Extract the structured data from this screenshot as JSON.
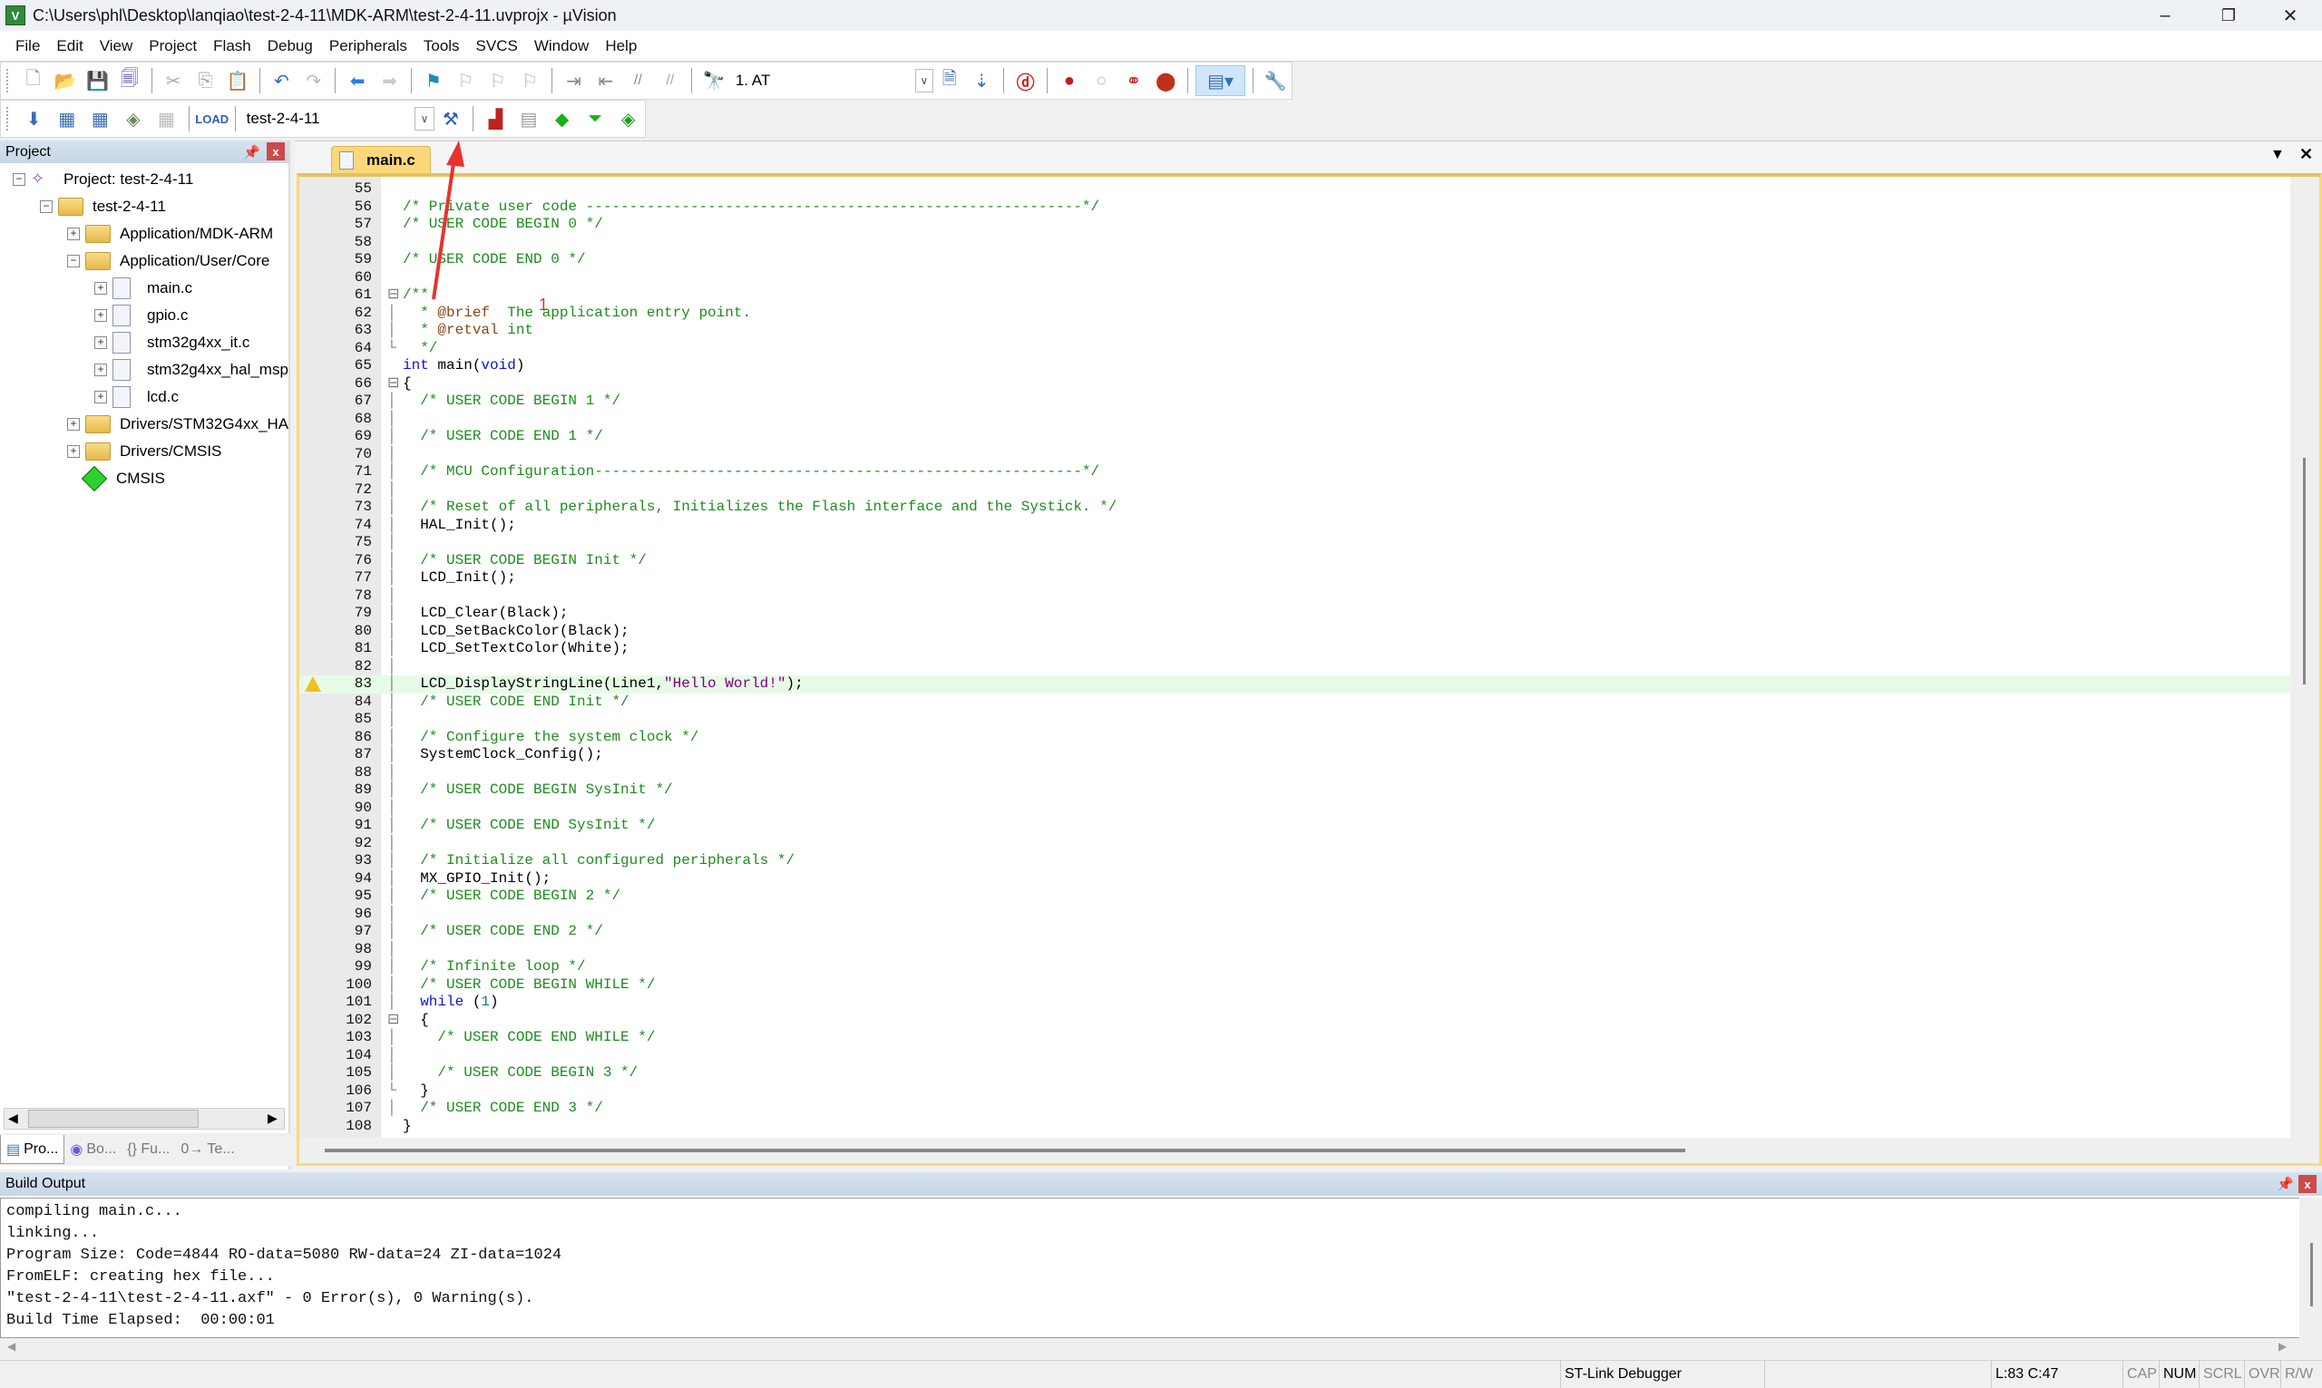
{
  "window": {
    "title": "C:\\Users\\phl\\Desktop\\lanqiao\\test-2-4-11\\MDK-ARM\\test-2-4-11.uvprojx - µVision",
    "minimize": "–",
    "restore": "❐",
    "close": "✕"
  },
  "menu": [
    "File",
    "Edit",
    "View",
    "Project",
    "Flash",
    "Debug",
    "Peripherals",
    "Tools",
    "SVCS",
    "Window",
    "Help"
  ],
  "toolbar1": {
    "icons": [
      "new-file-icon",
      "open-file-icon",
      "save-icon",
      "save-all-icon",
      "cut-icon",
      "copy-icon",
      "paste-icon",
      "undo-icon",
      "redo-icon",
      "navigate-back-icon",
      "navigate-forward-icon",
      "bookmark-icon",
      "prev-bookmark-icon",
      "next-bookmark-icon",
      "clear-bookmarks-icon",
      "indent-icon",
      "unindent-icon",
      "comment-icon",
      "uncomment-icon",
      "find-in-files-icon"
    ],
    "find_combo_value": "1. AT",
    "right_icons": [
      "find-icon",
      "incremental-find-icon",
      "debug-session-icon",
      "breakpoint-icon",
      "disable-breakpoint-icon",
      "disable-all-breakpoints-icon",
      "kill-all-breakpoints-icon",
      "window-layout-icon",
      "configure-icon"
    ]
  },
  "toolbar2": {
    "icons": [
      "translate-icon",
      "build-icon",
      "rebuild-icon",
      "batch-build-icon",
      "stop-build-icon",
      "download-icon"
    ],
    "target_value": "test-2-4-11",
    "right_icons": [
      "options-for-target-icon",
      "manage-project-items-icon",
      "select-packs-icon",
      "manage-run-time-environment-icon",
      "pack-installer-icon",
      "pack-manager-icon"
    ]
  },
  "project_panel": {
    "title": "Project",
    "tree": [
      {
        "label": "Project: test-2-4-11",
        "level": 0,
        "type": "project",
        "expander": "−"
      },
      {
        "label": "test-2-4-11",
        "level": 1,
        "type": "target",
        "expander": "−"
      },
      {
        "label": "Application/MDK-ARM",
        "level": 2,
        "type": "folder",
        "expander": "+"
      },
      {
        "label": "Application/User/Core",
        "level": 2,
        "type": "folder-open",
        "expander": "−"
      },
      {
        "label": "main.c",
        "level": 3,
        "type": "file",
        "expander": "+"
      },
      {
        "label": "gpio.c",
        "level": 3,
        "type": "file",
        "expander": "+"
      },
      {
        "label": "stm32g4xx_it.c",
        "level": 3,
        "type": "file",
        "expander": "+"
      },
      {
        "label": "stm32g4xx_hal_msp",
        "level": 3,
        "type": "file",
        "expander": "+"
      },
      {
        "label": "lcd.c",
        "level": 3,
        "type": "file",
        "expander": "+"
      },
      {
        "label": "Drivers/STM32G4xx_HA",
        "level": 2,
        "type": "folder",
        "expander": "+"
      },
      {
        "label": "Drivers/CMSIS",
        "level": 2,
        "type": "folder",
        "expander": "+"
      },
      {
        "label": "CMSIS",
        "level": 2,
        "type": "component",
        "expander": ""
      }
    ],
    "tabs": [
      "Pro...",
      "Bo...",
      "{} Fu...",
      "0→ Te..."
    ]
  },
  "editor": {
    "active_tab": "main.c",
    "highlighted_line": 83,
    "warning_line": 83,
    "lines": [
      {
        "n": 55,
        "t": ""
      },
      {
        "n": 56,
        "t": "/* Private user code ---------------------------------------------------------*/"
      },
      {
        "n": 57,
        "t": "/* USER CODE BEGIN 0 */"
      },
      {
        "n": 58,
        "t": ""
      },
      {
        "n": 59,
        "t": "/* USER CODE END 0 */"
      },
      {
        "n": 60,
        "t": ""
      },
      {
        "n": 61,
        "t": "/**"
      },
      {
        "n": 62,
        "t": "  * @brief  The application entry point."
      },
      {
        "n": 63,
        "t": "  * @retval int"
      },
      {
        "n": 64,
        "t": "  */"
      },
      {
        "n": 65,
        "t": "int main(void)"
      },
      {
        "n": 66,
        "t": "{"
      },
      {
        "n": 67,
        "t": "  /* USER CODE BEGIN 1 */"
      },
      {
        "n": 68,
        "t": ""
      },
      {
        "n": 69,
        "t": "  /* USER CODE END 1 */"
      },
      {
        "n": 70,
        "t": ""
      },
      {
        "n": 71,
        "t": "  /* MCU Configuration--------------------------------------------------------*/"
      },
      {
        "n": 72,
        "t": ""
      },
      {
        "n": 73,
        "t": "  /* Reset of all peripherals, Initializes the Flash interface and the Systick. */"
      },
      {
        "n": 74,
        "t": "  HAL_Init();"
      },
      {
        "n": 75,
        "t": ""
      },
      {
        "n": 76,
        "t": "  /* USER CODE BEGIN Init */"
      },
      {
        "n": 77,
        "t": "  LCD_Init();"
      },
      {
        "n": 78,
        "t": ""
      },
      {
        "n": 79,
        "t": "  LCD_Clear(Black);"
      },
      {
        "n": 80,
        "t": "  LCD_SetBackColor(Black);"
      },
      {
        "n": 81,
        "t": "  LCD_SetTextColor(White);"
      },
      {
        "n": 82,
        "t": ""
      },
      {
        "n": 83,
        "t": "  LCD_DisplayStringLine(Line1,\"Hello World!\");"
      },
      {
        "n": 84,
        "t": "  /* USER CODE END Init */"
      },
      {
        "n": 85,
        "t": ""
      },
      {
        "n": 86,
        "t": "  /* Configure the system clock */"
      },
      {
        "n": 87,
        "t": "  SystemClock_Config();"
      },
      {
        "n": 88,
        "t": ""
      },
      {
        "n": 89,
        "t": "  /* USER CODE BEGIN SysInit */"
      },
      {
        "n": 90,
        "t": ""
      },
      {
        "n": 91,
        "t": "  /* USER CODE END SysInit */"
      },
      {
        "n": 92,
        "t": ""
      },
      {
        "n": 93,
        "t": "  /* Initialize all configured peripherals */"
      },
      {
        "n": 94,
        "t": "  MX_GPIO_Init();"
      },
      {
        "n": 95,
        "t": "  /* USER CODE BEGIN 2 */"
      },
      {
        "n": 96,
        "t": ""
      },
      {
        "n": 97,
        "t": "  /* USER CODE END 2 */"
      },
      {
        "n": 98,
        "t": ""
      },
      {
        "n": 99,
        "t": "  /* Infinite loop */"
      },
      {
        "n": 100,
        "t": "  /* USER CODE BEGIN WHILE */"
      },
      {
        "n": 101,
        "t": "  while (1)"
      },
      {
        "n": 102,
        "t": "  {"
      },
      {
        "n": 103,
        "t": "    /* USER CODE END WHILE */"
      },
      {
        "n": 104,
        "t": ""
      },
      {
        "n": 105,
        "t": "    /* USER CODE BEGIN 3 */"
      },
      {
        "n": 106,
        "t": "  }"
      },
      {
        "n": 107,
        "t": "  /* USER CODE END 3 */"
      },
      {
        "n": 108,
        "t": "}"
      }
    ],
    "fold_markers": {
      "61": "⊟",
      "64": "└",
      "66": "⊟",
      "102": "⊟",
      "106": "└"
    }
  },
  "annotation": {
    "label": "1",
    "color": "#e8322e"
  },
  "build_output": {
    "title": "Build Output",
    "lines": [
      "compiling main.c...",
      "linking...",
      "Program Size: Code=4844 RO-data=5080 RW-data=24 ZI-data=1024",
      "FromELF: creating hex file...",
      "\"test-2-4-11\\test-2-4-11.axf\" - 0 Error(s), 0 Warning(s).",
      "Build Time Elapsed:  00:00:01"
    ]
  },
  "status": {
    "debugger": "ST-Link Debugger",
    "position": "L:83 C:47",
    "caps": "CAP",
    "num": "NUM",
    "scrl": "SCRL",
    "ovr": "OVR",
    "rw": "R/W"
  }
}
